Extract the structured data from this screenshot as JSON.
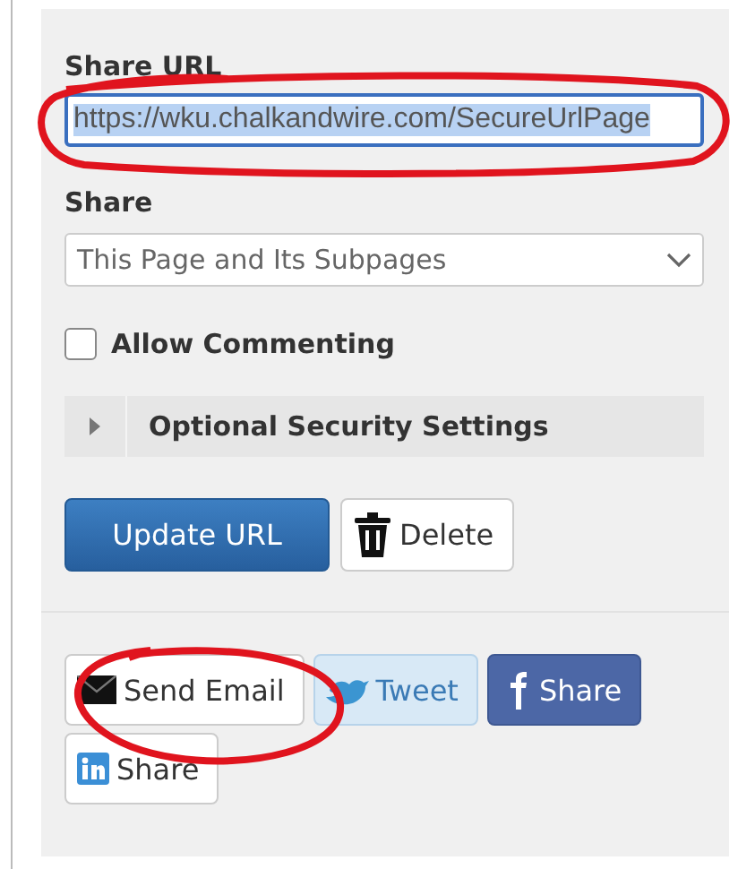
{
  "share_url": {
    "label": "Share URL",
    "value": "https://wku.chalkandwire.com/SecureUrlPage",
    "selected": true
  },
  "share": {
    "label": "Share",
    "value": "This Page and Its Subpages"
  },
  "allow_commenting": {
    "label": "Allow Commenting",
    "checked": false
  },
  "optional_security": {
    "label": "Optional Security Settings",
    "expanded": false
  },
  "actions": [
    {
      "kind": "primary",
      "label": "Update URL"
    },
    {
      "kind": "delete",
      "label": "Delete"
    }
  ],
  "social": [
    {
      "kind": "email",
      "label": "Send Email"
    },
    {
      "kind": "twitter",
      "label": "Tweet"
    },
    {
      "kind": "facebook",
      "label": "Share"
    },
    {
      "kind": "linkedin",
      "label": "Share"
    }
  ]
}
